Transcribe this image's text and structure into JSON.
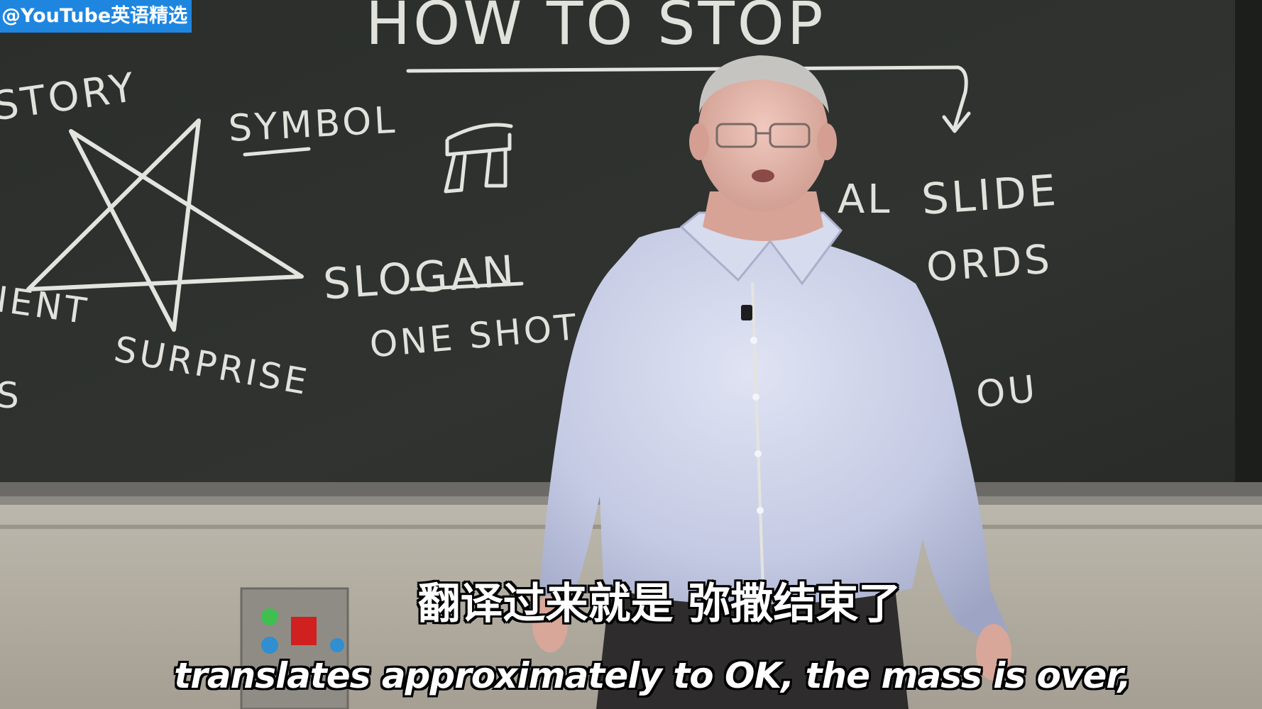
{
  "watermark": "@YouTube英语精选",
  "board": {
    "heading": "HOW TO STOP",
    "words": {
      "story": "STORY",
      "symbol": "SYMBOL",
      "slogan": "SLOGAN",
      "one_shot": "ONE SHOT",
      "surprise": "SURPRISE",
      "ient": "IENT",
      "s": "S",
      "al": "AL",
      "slide": "SLIDE",
      "ords": "ORDS",
      "ou": "OU"
    }
  },
  "subtitles": {
    "chinese": "翻译过来就是 弥撒结束了",
    "english": "translates approximately to OK, the mass is over,"
  },
  "colors": {
    "chalkboard": "#2c2f2c",
    "chalk": "#e4e4df",
    "shirt": "#c7cde6",
    "watermark_bg": "#1f86e0",
    "subtitle_text": "#ffffff"
  }
}
